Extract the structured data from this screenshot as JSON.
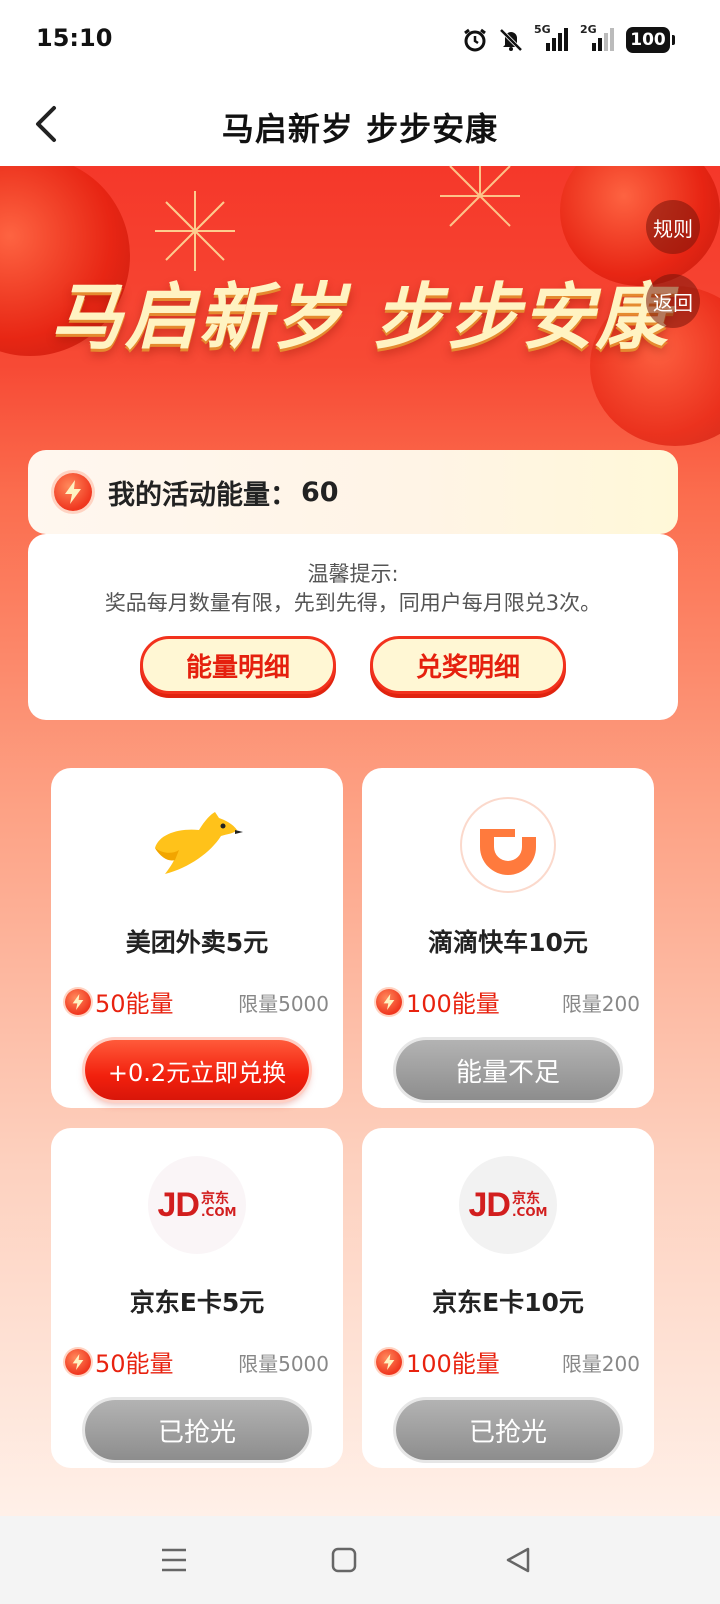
{
  "status_bar": {
    "time": "15:10",
    "network_1": "5G",
    "network_2": "2G",
    "battery": "100",
    "icons": [
      "alarm-icon",
      "mute-icon",
      "signal-5g-icon",
      "signal-2g-icon",
      "battery-icon"
    ]
  },
  "navbar": {
    "title": "马启新岁 步步安康"
  },
  "hero": {
    "title": "马启新岁 步步安康",
    "rules_label": "规则",
    "return_label": "返回"
  },
  "energy": {
    "label": "我的活动能量：",
    "value": "60"
  },
  "tips": {
    "title": "温馨提示:",
    "text": "奖品每月数量有限，先到先得，同用户每月限兑3次。",
    "energy_detail_button": "能量明细",
    "redeem_detail_button": "兑奖明细"
  },
  "prizes": [
    {
      "name": "美团外卖5元",
      "cost": "50能量",
      "limit": "限量5000",
      "button": "+0.2元立即兑换",
      "state": "active",
      "logo": "meituan-kangaroo-icon"
    },
    {
      "name": "滴滴快车10元",
      "cost": "100能量",
      "limit": "限量200",
      "button": "能量不足",
      "state": "disabled",
      "logo": "didi-logo-icon"
    },
    {
      "name": "京东E卡5元",
      "cost": "50能量",
      "limit": "限量5000",
      "button": "已抢光",
      "state": "disabled",
      "logo": "jd-logo-icon",
      "logo_text": "JD",
      "logo_sub1": "京东",
      "logo_sub2": ".COM"
    },
    {
      "name": "京东E卡10元",
      "cost": "100能量",
      "limit": "限量200",
      "button": "已抢光",
      "state": "disabled",
      "logo": "jd-logo-icon",
      "logo_text": "JD",
      "logo_sub1": "京东",
      "logo_sub2": ".COM"
    }
  ],
  "colors": {
    "accent_red": "#f2321d",
    "pill_bg": "#fff7d4",
    "disabled_gray": "#9a9a9a"
  },
  "system_nav": {
    "icons": [
      "menu-icon",
      "home-icon",
      "back-triangle-icon"
    ]
  }
}
